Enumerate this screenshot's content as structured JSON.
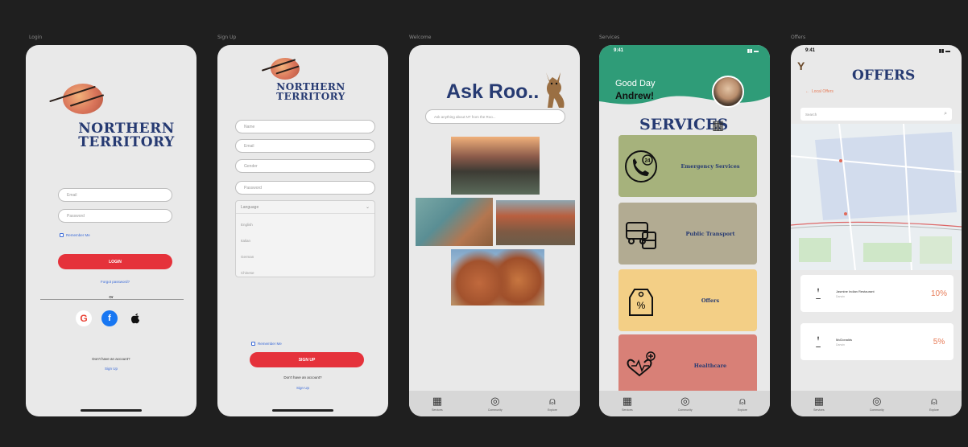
{
  "frames": {
    "login": "Login",
    "signup": "Sign Up",
    "welcome": "Welcome",
    "services": "Services",
    "offers": "Offers"
  },
  "logo": {
    "line1": "NORTHERN",
    "line2": "TERRITORY"
  },
  "login": {
    "email_placeholder": "Email",
    "password_placeholder": "Password",
    "remember": "Remember Me",
    "login_button": "LOGIN",
    "forgot": "Forgot password?",
    "or": "Or",
    "no_account": "Don't have an account?",
    "sign_up": "Sign Up"
  },
  "signup": {
    "name_placeholder": "Name",
    "email_placeholder": "Email",
    "gender_placeholder": "Gender",
    "password_placeholder": "Password",
    "language_placeholder": "Language",
    "languages": [
      "English",
      "Italian",
      "German",
      "Chinese"
    ],
    "remember": "Remember Me",
    "sign_up_button": "SIGN UP",
    "have_account": "Don't have an account?",
    "sign_in": "Sign Up"
  },
  "ask": {
    "title": "Ask Roo..",
    "search_placeholder": "Ask anything about NT from the Roo..."
  },
  "services": {
    "time": "9:41",
    "greeting": "Good Day",
    "name": "Andrew!",
    "title": "SERVICES",
    "items": [
      "Emergency Services",
      "Public Transport",
      "Offers",
      "Healthcare"
    ],
    "emergency_number": "24"
  },
  "offers_screen": {
    "time": "9:41",
    "title": "OFFERS",
    "back": "Local Offers",
    "search_placeholder": "Search",
    "list": [
      {
        "name": "Jasmine Indian Restaurant",
        "sub": "Darwin",
        "pct": "10%"
      },
      {
        "name": "McDonalds",
        "sub": "Darwin",
        "pct": "5%"
      }
    ]
  },
  "tabs": [
    "Services",
    "Community",
    "Explore"
  ],
  "colors": {
    "accent_red": "#e5323b",
    "brand_navy": "#263a72",
    "services_green": "#2f9c78",
    "card_green": "#a6b27c",
    "card_grey": "#b2ab92",
    "card_yellow": "#f3cf86",
    "card_red": "#d88077"
  }
}
